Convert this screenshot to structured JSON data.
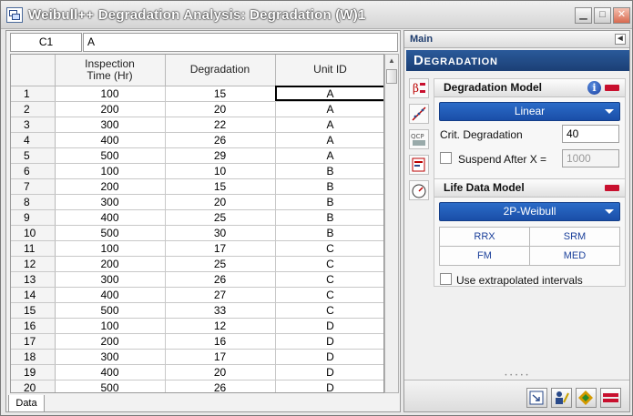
{
  "window": {
    "title": "Weibull++ Degradation Analysis: Degradation (W)1"
  },
  "formula_bar": {
    "cell_ref": "C1",
    "cell_value": "A"
  },
  "grid": {
    "headers": [
      "Inspection\nTime (Hr)",
      "Degradation",
      "Unit ID"
    ],
    "rows": [
      [
        "1",
        "100",
        "15",
        "A"
      ],
      [
        "2",
        "200",
        "20",
        "A"
      ],
      [
        "3",
        "300",
        "22",
        "A"
      ],
      [
        "4",
        "400",
        "26",
        "A"
      ],
      [
        "5",
        "500",
        "29",
        "A"
      ],
      [
        "6",
        "100",
        "10",
        "B"
      ],
      [
        "7",
        "200",
        "15",
        "B"
      ],
      [
        "8",
        "300",
        "20",
        "B"
      ],
      [
        "9",
        "400",
        "25",
        "B"
      ],
      [
        "10",
        "500",
        "30",
        "B"
      ],
      [
        "11",
        "100",
        "17",
        "C"
      ],
      [
        "12",
        "200",
        "25",
        "C"
      ],
      [
        "13",
        "300",
        "26",
        "C"
      ],
      [
        "14",
        "400",
        "27",
        "C"
      ],
      [
        "15",
        "500",
        "33",
        "C"
      ],
      [
        "16",
        "100",
        "12",
        "D"
      ],
      [
        "17",
        "200",
        "16",
        "D"
      ],
      [
        "18",
        "300",
        "17",
        "D"
      ],
      [
        "19",
        "400",
        "20",
        "D"
      ],
      [
        "20",
        "500",
        "26",
        "D"
      ]
    ]
  },
  "sheet_tab": {
    "label": "Data"
  },
  "side": {
    "main_label": "Main",
    "banner": "Degradation",
    "degradation_model": {
      "title": "Degradation Model",
      "model": "Linear",
      "crit_label": "Crit. Degradation",
      "crit_value": "40",
      "suspend_label": "Suspend After X =",
      "suspend_value": "1000"
    },
    "life_data_model": {
      "title": "Life Data Model",
      "model": "2P-Weibull",
      "buttons": [
        "RRX",
        "SRM",
        "FM",
        "MED"
      ],
      "extrapolated_label": "Use extrapolated intervals"
    },
    "tools": {
      "beta_label": "β",
      "qcp_label": "QCP"
    },
    "colors": {
      "accent": "#1a4ea8",
      "minus": "#c8102e"
    }
  }
}
